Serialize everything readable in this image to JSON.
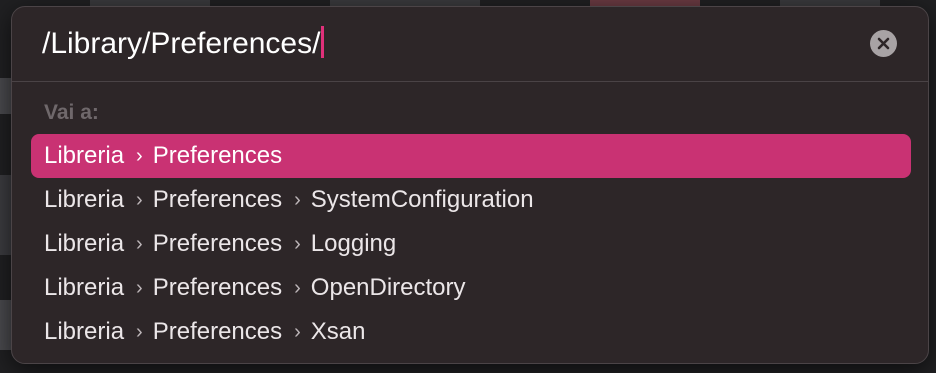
{
  "search": {
    "value": "/Library/Preferences/"
  },
  "clear_icon": "close-icon",
  "section_label": "Vai a:",
  "separator_glyph": "›",
  "results": [
    {
      "segments": [
        "Libreria",
        "Preferences"
      ],
      "selected": true
    },
    {
      "segments": [
        "Libreria",
        "Preferences",
        "SystemConfiguration"
      ],
      "selected": false
    },
    {
      "segments": [
        "Libreria",
        "Preferences",
        "Logging"
      ],
      "selected": false
    },
    {
      "segments": [
        "Libreria",
        "Preferences",
        "OpenDirectory"
      ],
      "selected": false
    },
    {
      "segments": [
        "Libreria",
        "Preferences",
        "Xsan"
      ],
      "selected": false
    }
  ],
  "colors": {
    "accent": "#c93273",
    "caret": "#e0307a",
    "panel": "#2d2628"
  }
}
